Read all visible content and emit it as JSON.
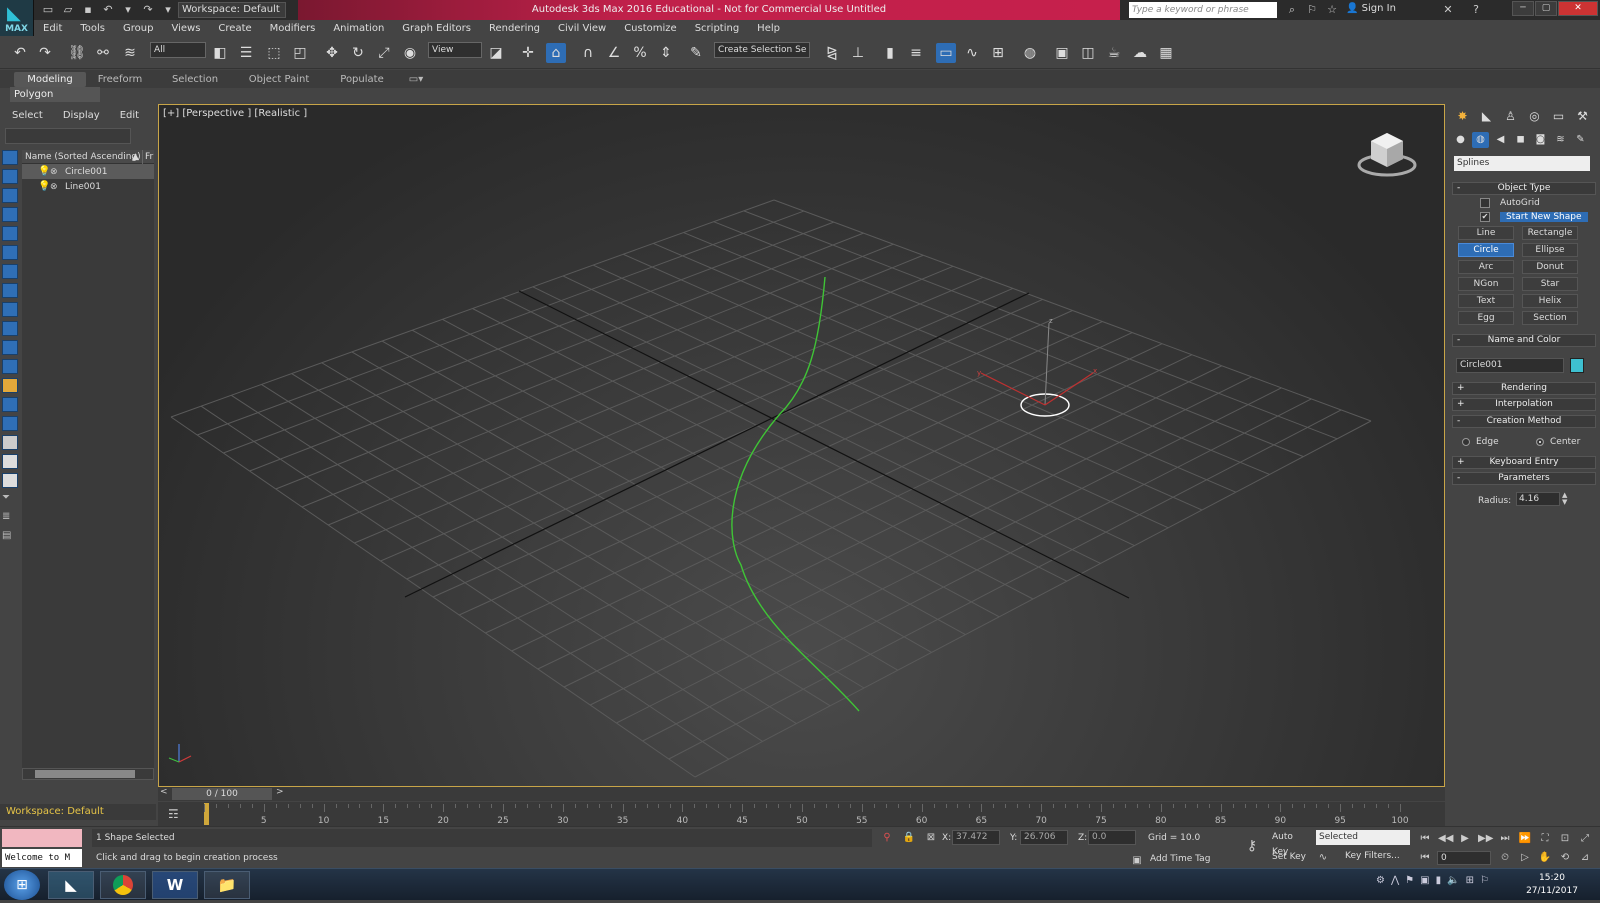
{
  "app": {
    "logo_label": "MAX",
    "workspace_dropdown": "Workspace: Default",
    "title": "Autodesk 3ds Max 2016 Educational - Not for Commercial Use    Untitled",
    "search_placeholder": "Type a keyword or phrase",
    "sign_in": "Sign In",
    "accent_color": "#2e6db5",
    "title_gradient_color": "#c6204c"
  },
  "menu": [
    "Edit",
    "Tools",
    "Group",
    "Views",
    "Create",
    "Modifiers",
    "Animation",
    "Graph Editors",
    "Rendering",
    "Civil View",
    "Customize",
    "Scripting",
    "Help"
  ],
  "toolbar": {
    "selection_filter": "All",
    "ref_coord": "View",
    "named_selection_placeholder": "Create Selection Se"
  },
  "ribbon": {
    "tabs": [
      "Modeling",
      "Freeform",
      "Selection",
      "Object Paint",
      "Populate"
    ],
    "sub_label": "Polygon Modeling"
  },
  "scene_explorer": {
    "menu": [
      "Select",
      "Display",
      "Edit"
    ],
    "column_header": "Name (Sorted Ascending)",
    "column_header_short": "Fr",
    "objects": [
      {
        "name": "Circle001",
        "selected": true
      },
      {
        "name": "Line001",
        "selected": false
      }
    ],
    "workspace_footer": "Workspace: Default"
  },
  "viewport": {
    "label": "[+] [Perspective ] [Realistic ]",
    "gizmo_axes": [
      "x",
      "y",
      "z"
    ]
  },
  "command_panel": {
    "category_dropdown": "Splines",
    "object_type": {
      "title": "Object Type",
      "autogrid": "AutoGrid",
      "start_new_shape": "Start New Shape",
      "buttons": [
        "Line",
        "Rectangle",
        "Circle",
        "Ellipse",
        "Arc",
        "Donut",
        "NGon",
        "Star",
        "Text",
        "Helix",
        "Egg",
        "Section"
      ],
      "active_button": "Circle"
    },
    "name_and_color": {
      "title": "Name and Color",
      "name": "Circle001",
      "color": "#3ec0d0"
    },
    "rollouts": {
      "rendering": "Rendering",
      "interpolation": "Interpolation",
      "creation_method": "Creation Method",
      "keyboard_entry": "Keyboard Entry",
      "parameters": "Parameters"
    },
    "creation_method_options": [
      "Edge",
      "Center"
    ],
    "creation_method_selected": "Center",
    "radius_label": "Radius:",
    "radius_value": "4.16"
  },
  "timeline": {
    "slider_text": "0 / 100",
    "ticks": [
      "5",
      "10",
      "15",
      "20",
      "25",
      "30",
      "35",
      "40",
      "45",
      "50",
      "55",
      "60",
      "65",
      "70",
      "75",
      "80",
      "85",
      "90",
      "95",
      "100"
    ]
  },
  "status": {
    "maxscript_text": "Welcome to M",
    "selection": "1 Shape Selected",
    "prompt": "Click and drag to begin creation process",
    "x_label": "X:",
    "x_value": "37.472",
    "y_label": "Y:",
    "y_value": "26.706",
    "z_label": "Z:",
    "z_value": "0.0",
    "grid": "Grid = 10.0",
    "add_time_tag": "Add Time Tag",
    "auto_key": "Auto Key",
    "set_key": "Set Key",
    "key_mode": "Selected",
    "key_filters": "Key Filters...",
    "frame": "0"
  },
  "taskbar": {
    "time": "15:20",
    "date": "27/11/2017",
    "word_label": "W"
  }
}
